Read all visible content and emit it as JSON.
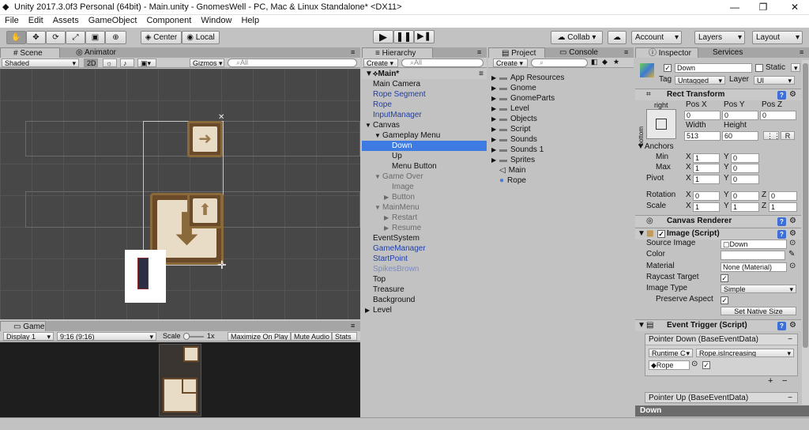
{
  "window": {
    "title": "Unity 2017.3.0f3 Personal (64bit) - Main.unity - GnomesWell - PC, Mac & Linux Standalone* <DX11>"
  },
  "menu": [
    "File",
    "Edit",
    "Assets",
    "GameObject",
    "Component",
    "Window",
    "Help"
  ],
  "toolbar": {
    "center": "Center",
    "local": "Local",
    "collab": "Collab",
    "account": "Account",
    "layers": "Layers",
    "layout": "Layout"
  },
  "scene": {
    "tab_scene": "Scene",
    "tab_animator": "Animator",
    "shading": "Shaded",
    "mode_2d": "2D",
    "gizmos": "Gizmos",
    "search_placeholder": "All"
  },
  "game": {
    "tab": "Game",
    "display": "Display 1",
    "aspect": "9:16 (9:16)",
    "scale_label": "Scale",
    "scale_value": "1x",
    "maximize": "Maximize On Play",
    "mute": "Mute Audio",
    "stats": "Stats"
  },
  "hierarchy": {
    "tab": "Hierarchy",
    "create": "Create",
    "search_placeholder": "All",
    "scene_name": "Main*",
    "items": [
      {
        "label": "Main Camera",
        "indent": 0,
        "style": "normal",
        "arrow": ""
      },
      {
        "label": "Rope Segment",
        "indent": 0,
        "style": "blue",
        "arrow": ""
      },
      {
        "label": "Rope",
        "indent": 0,
        "style": "blue",
        "arrow": ""
      },
      {
        "label": "InputManager",
        "indent": 0,
        "style": "blue",
        "arrow": ""
      },
      {
        "label": "Canvas",
        "indent": 0,
        "style": "normal",
        "arrow": "▼"
      },
      {
        "label": "Gameplay Menu",
        "indent": 1,
        "style": "normal",
        "arrow": "▼"
      },
      {
        "label": "Down",
        "indent": 2,
        "style": "selected",
        "arrow": ""
      },
      {
        "label": "Up",
        "indent": 2,
        "style": "normal",
        "arrow": ""
      },
      {
        "label": "Menu Button",
        "indent": 2,
        "style": "normal",
        "arrow": ""
      },
      {
        "label": "Game Over",
        "indent": 1,
        "style": "dim",
        "arrow": "▼"
      },
      {
        "label": "Image",
        "indent": 2,
        "style": "dim",
        "arrow": ""
      },
      {
        "label": "Button",
        "indent": 2,
        "style": "dim",
        "arrow": "▶"
      },
      {
        "label": "MainMenu",
        "indent": 1,
        "style": "dim",
        "arrow": "▼"
      },
      {
        "label": "Restart",
        "indent": 2,
        "style": "dim",
        "arrow": "▶"
      },
      {
        "label": "Resume",
        "indent": 2,
        "style": "dim",
        "arrow": "▶"
      },
      {
        "label": "EventSystem",
        "indent": 0,
        "style": "normal",
        "arrow": ""
      },
      {
        "label": "GameManager",
        "indent": 0,
        "style": "blue",
        "arrow": ""
      },
      {
        "label": "StartPoint",
        "indent": 0,
        "style": "blue",
        "arrow": ""
      },
      {
        "label": "SpikesBrown",
        "indent": 0,
        "style": "dimblue",
        "arrow": ""
      },
      {
        "label": "Top",
        "indent": 0,
        "style": "normal",
        "arrow": ""
      },
      {
        "label": "Treasure",
        "indent": 0,
        "style": "normal",
        "arrow": ""
      },
      {
        "label": "Background",
        "indent": 0,
        "style": "normal",
        "arrow": ""
      },
      {
        "label": "Level",
        "indent": 0,
        "style": "normal",
        "arrow": "▶"
      }
    ]
  },
  "project": {
    "tab_project": "Project",
    "tab_console": "Console",
    "create": "Create",
    "items": [
      {
        "label": "App Resources",
        "icon": "folder"
      },
      {
        "label": "Gnome",
        "icon": "folder"
      },
      {
        "label": "GnomeParts",
        "icon": "folder"
      },
      {
        "label": "Level",
        "icon": "folder"
      },
      {
        "label": "Objects",
        "icon": "folder"
      },
      {
        "label": "Script",
        "icon": "folder"
      },
      {
        "label": "Sounds",
        "icon": "folder"
      },
      {
        "label": "Sounds 1",
        "icon": "folder"
      },
      {
        "label": "Sprites",
        "icon": "folder"
      },
      {
        "label": "Main",
        "icon": "unity"
      },
      {
        "label": "Rope",
        "icon": "prefab"
      }
    ]
  },
  "inspector": {
    "tab_inspector": "Inspector",
    "tab_services": "Services",
    "object_name": "Down",
    "static_label": "Static",
    "tag_label": "Tag",
    "tag_value": "Untagged",
    "layer_label": "Layer",
    "layer_value": "UI",
    "rect_transform": {
      "title": "Rect Transform",
      "anchor_h": "right",
      "anchor_v": "bottom",
      "pos_x_label": "Pos X",
      "pos_y_label": "Pos Y",
      "pos_z_label": "Pos Z",
      "pos_x": "0",
      "pos_y": "0",
      "pos_z": "0",
      "width_label": "Width",
      "height_label": "Height",
      "width": "513",
      "height": "60",
      "anchors_label": "Anchors",
      "min_label": "Min",
      "max_label": "Max",
      "pivot_label": "Pivot",
      "min_x": "1",
      "min_y": "0",
      "max_x": "1",
      "max_y": "0",
      "pivot_x": "1",
      "pivot_y": "0",
      "rotation_label": "Rotation",
      "scale_label": "Scale",
      "rot_x": "0",
      "rot_y": "0",
      "rot_z": "0",
      "scale_x": "1",
      "scale_y": "1",
      "scale_z": "1",
      "x": "X",
      "y": "Y",
      "z": "Z",
      "r_btn": "R"
    },
    "canvas_renderer": {
      "title": "Canvas Renderer"
    },
    "image": {
      "title": "Image (Script)",
      "source_label": "Source Image",
      "source_value": "Down",
      "color_label": "Color",
      "material_label": "Material",
      "material_value": "None (Material)",
      "raycast_label": "Raycast Target",
      "type_label": "Image Type",
      "type_value": "Simple",
      "preserve_label": "Preserve Aspect",
      "native_btn": "Set Native Size"
    },
    "event_trigger": {
      "title": "Event Trigger (Script)",
      "pointer_down": "Pointer Down (BaseEventData)",
      "runtime": "Runtime C",
      "function": "Rope.isIncreasing",
      "object": "Rope",
      "plus": "+",
      "minus": "−",
      "pointer_up": "Pointer Up (BaseEventData)"
    },
    "footer": "Down"
  },
  "colors": {
    "selection": "#3d7be2",
    "prefab_blue": "#1f3ea8",
    "scene_bg": "#474747"
  }
}
